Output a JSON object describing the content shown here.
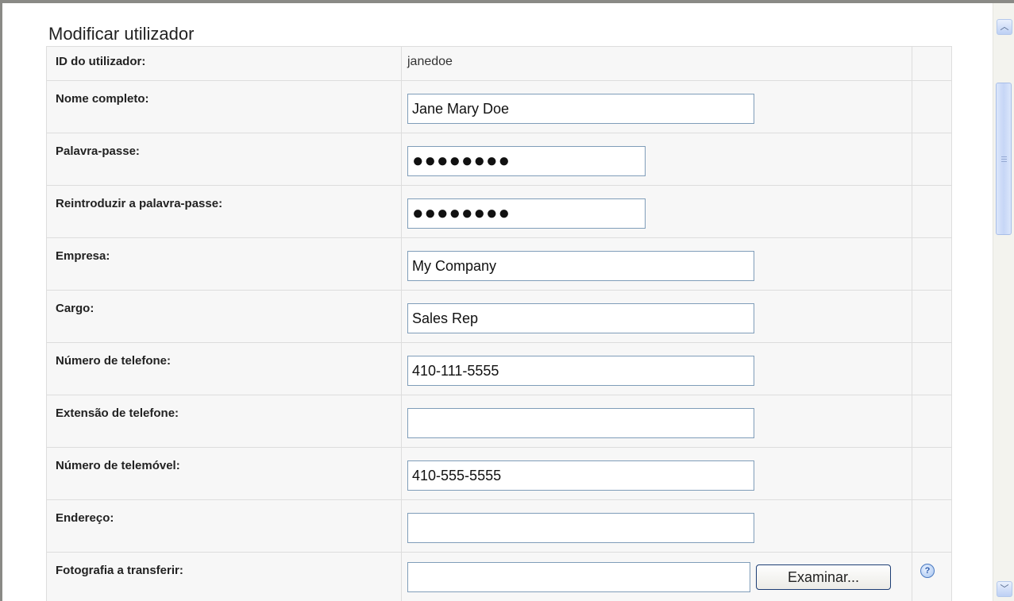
{
  "page": {
    "title": "Modificar utilizador"
  },
  "form": {
    "user_id": {
      "label": "ID do utilizador:",
      "value": "janedoe"
    },
    "full_name": {
      "label": "Nome completo:",
      "value": "Jane Mary Doe"
    },
    "password": {
      "label": "Palavra-passe:",
      "value": "●●●●●●●●"
    },
    "password_confirm": {
      "label": "Reintroduzir a palavra-passe:",
      "value": "●●●●●●●●"
    },
    "company": {
      "label": "Empresa:",
      "value": "My Company"
    },
    "job_title": {
      "label": "Cargo:",
      "value": "Sales Rep"
    },
    "phone": {
      "label": "Número de telefone:",
      "value": "410-111-5555"
    },
    "phone_ext": {
      "label": "Extensão de telefone:",
      "value": ""
    },
    "mobile": {
      "label": "Número de telemóvel:",
      "value": "410-555-5555"
    },
    "address": {
      "label": "Endereço:",
      "value": ""
    },
    "photo": {
      "label": "Fotografia a transferir:",
      "value": "",
      "browse_label": "Examinar..."
    },
    "help_glyph": "?"
  },
  "scrollbar": {
    "up_glyph": "︿",
    "down_glyph": "﹀"
  },
  "icons": {
    "help": "help-icon",
    "scroll_up": "chevron-up-icon",
    "scroll_down": "chevron-down-icon"
  }
}
